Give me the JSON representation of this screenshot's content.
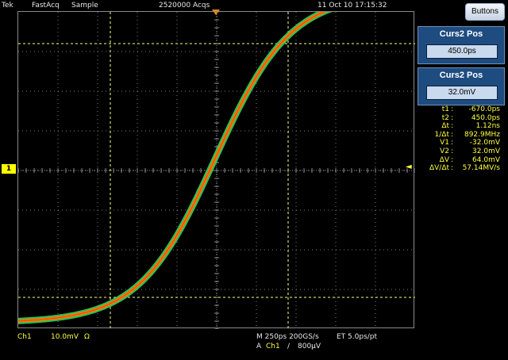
{
  "status": {
    "brand": "Tek",
    "mode": "FastAcq",
    "acq_mode": "Sample",
    "acqs": "2520000 Acqs",
    "datetime": "11 Oct 10 17:15:32"
  },
  "buttons_label": "Buttons",
  "cursor_panels": [
    {
      "title": "Curs2 Pos",
      "value": "450.0ps"
    },
    {
      "title": "Curs2 Pos",
      "value": "32.0mV"
    }
  ],
  "readout": [
    {
      "label": "t1",
      "value": "-670.0ps"
    },
    {
      "label": "t2",
      "value": "450.0ps"
    },
    {
      "label": "Δt",
      "value": "1.12ns"
    },
    {
      "label": "1/Δt",
      "value": "892.9MHz"
    },
    {
      "label": "V1",
      "value": "-32.0mV"
    },
    {
      "label": "V2",
      "value": "32.0mV"
    },
    {
      "label": "ΔV",
      "value": "64.0mV"
    },
    {
      "label": "ΔV/Δt",
      "value": "57.14MV/s"
    }
  ],
  "bottom": {
    "channel": "Ch1",
    "scale": "10.0mV",
    "coupling_symbol": "Ω",
    "timebase": "M 250ps 200GS/s",
    "et": "ET 5.0ps/pt",
    "trigger_prefix": "A",
    "trigger_channel": "Ch1",
    "trigger_slope_symbol": "/",
    "trigger_level": "800µV"
  },
  "ch1_marker_label": "1",
  "colors": {
    "trace": "#ff7a00",
    "trace_envelope": "#22d86a",
    "readout": "#ffff40",
    "panel": "#1e4c80",
    "cursor": "#ffff80"
  }
}
